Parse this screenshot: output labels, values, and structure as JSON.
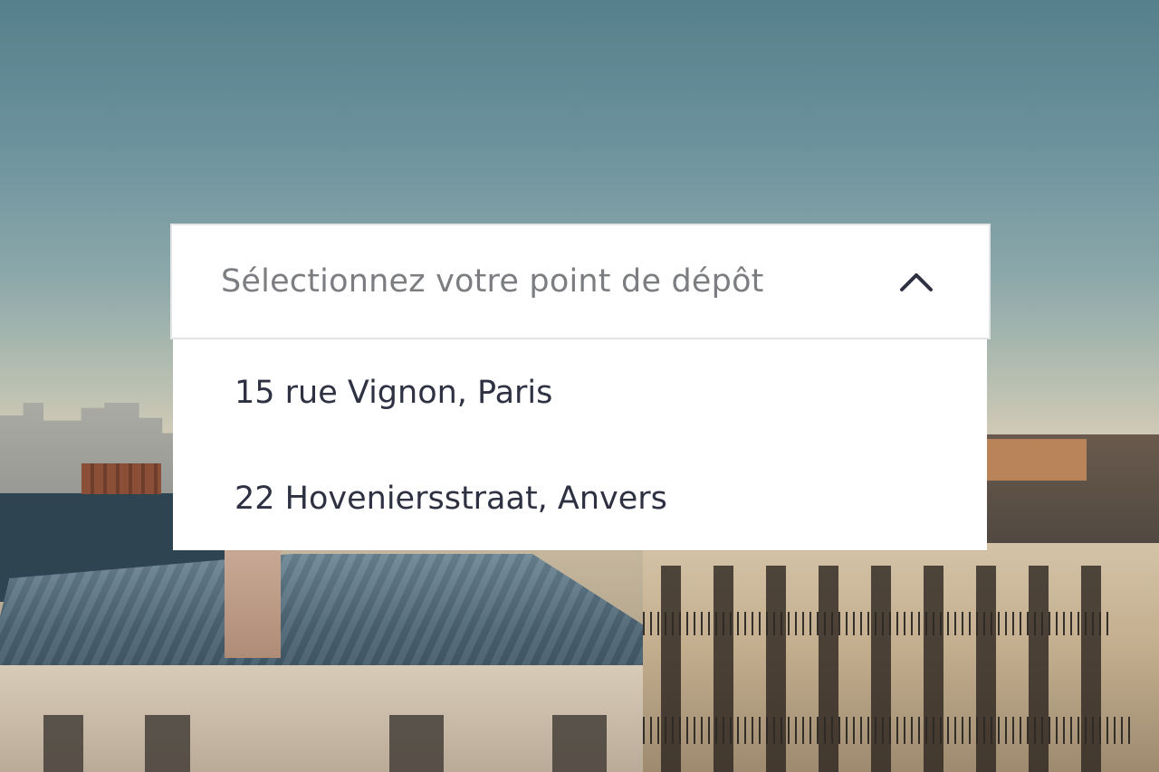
{
  "dropdown": {
    "placeholder": "Sélectionnez votre point de dépôt",
    "toggle_icon": "chevron-up-icon",
    "options": [
      "15 rue Vignon, Paris",
      "22 Hoveniersstraat, Anvers"
    ]
  },
  "colors": {
    "dropdown_background": "#ffffff",
    "placeholder_text": "#7b7d81",
    "option_text": "#2d3142",
    "border": "#e3e4e6"
  }
}
